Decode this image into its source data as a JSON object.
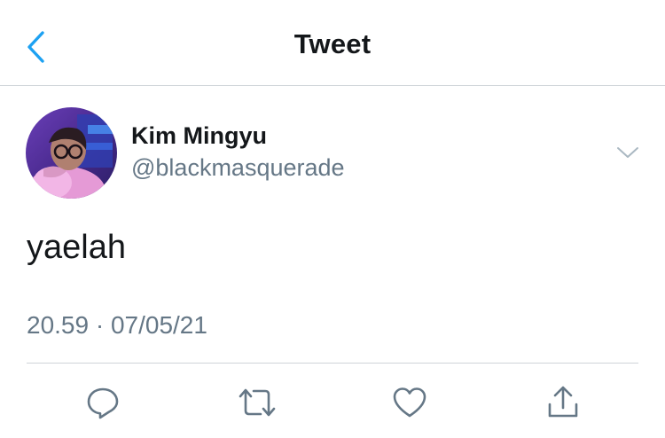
{
  "header": {
    "title": "Tweet",
    "back_icon": "chevron-left-icon"
  },
  "tweet": {
    "author_name": "Kim Mingyu",
    "author_handle": "@blackmasquerade",
    "text": "yaelah",
    "meta": "20.59 · 07/05/21",
    "menu_icon": "chevron-down-icon"
  },
  "actions": [
    {
      "icon": "reply-icon"
    },
    {
      "icon": "retweet-icon"
    },
    {
      "icon": "like-icon"
    },
    {
      "icon": "share-icon"
    }
  ],
  "colors": {
    "accent": "#1da1f2",
    "text_primary": "#14171a",
    "text_secondary": "#657786",
    "divider": "#cfd4d8"
  }
}
